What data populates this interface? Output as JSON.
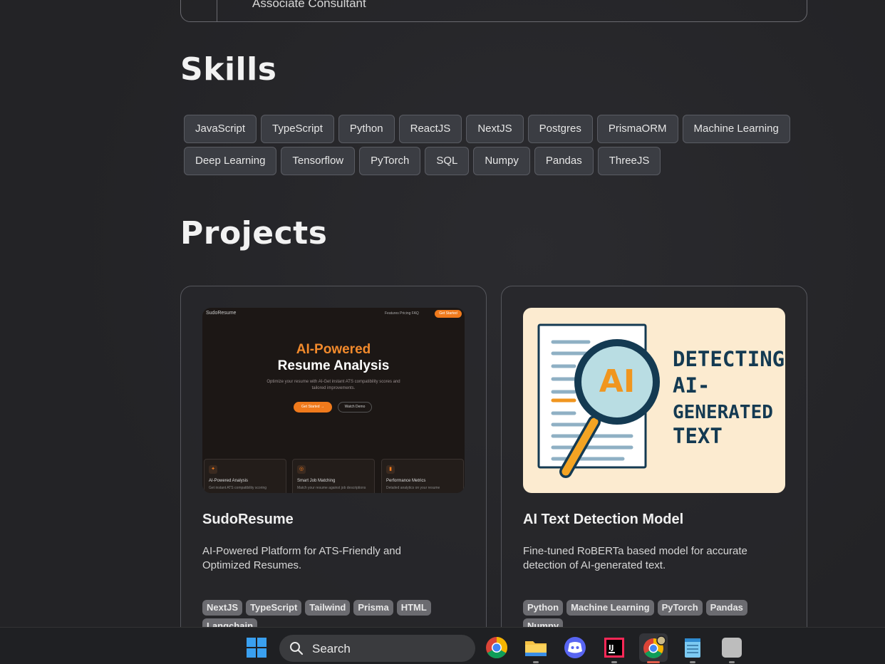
{
  "experience": {
    "role": "Associate Consultant"
  },
  "skills": {
    "title": "Skills",
    "items": [
      "JavaScript",
      "TypeScript",
      "Python",
      "ReactJS",
      "NextJS",
      "Postgres",
      "PrismaORM",
      "Machine Learning",
      "Deep Learning",
      "Tensorflow",
      "PyTorch",
      "SQL",
      "Numpy",
      "Pandas",
      "ThreeJS"
    ]
  },
  "projects": {
    "title": "Projects",
    "cards": [
      {
        "title": "SudoResume",
        "description": "AI-Powered Platform for ATS-Friendly and Optimized Resumes.",
        "tags": [
          "NextJS",
          "TypeScript",
          "Tailwind",
          "Prisma",
          "HTML",
          "Langchain"
        ],
        "thumbnail": {
          "brand": "SudoResume",
          "nav_links": "Features   Pricing   FAQ",
          "cta": "Get Started",
          "headline_accent": "AI-Powered",
          "headline": "Resume Analysis",
          "subtitle": "Optimize your resume with AI-Get instant ATS compatibility scores and tailored improvements.",
          "primary_button": "Get Started →",
          "secondary_button": "Watch Demo",
          "features": [
            {
              "title": "AI-Powered Analysis",
              "desc": "Get instant ATS compatibility scoring"
            },
            {
              "title": "Smart Job Matching",
              "desc": "Match your resume against job descriptions"
            },
            {
              "title": "Performance Metrics",
              "desc": "Detailed analytics on your resume"
            }
          ]
        }
      },
      {
        "title": "AI Text Detection Model",
        "description": "Fine-tuned RoBERTa based model for accurate detection of AI-generated text.",
        "tags": [
          "Python",
          "Machine Learning",
          "PyTorch",
          "Pandas",
          "Numpy"
        ],
        "thumbnail": {
          "badge": "AI",
          "line1": "DETECTING",
          "line2": "AI-",
          "line3": "GENERATED",
          "line4": "TEXT"
        }
      }
    ]
  },
  "taskbar": {
    "search_label": "Search",
    "apps": [
      "windows-start",
      "chrome",
      "file-explorer",
      "discord",
      "intellij",
      "chrome-profile",
      "notepad",
      "app-placeholder"
    ]
  },
  "colors": {
    "accent_orange": "#f07a1c",
    "thumb_cream": "#fcebd0",
    "navy": "#143a52",
    "skill_bg": "#3b3d43",
    "tag_bg": "#6b6b70"
  }
}
